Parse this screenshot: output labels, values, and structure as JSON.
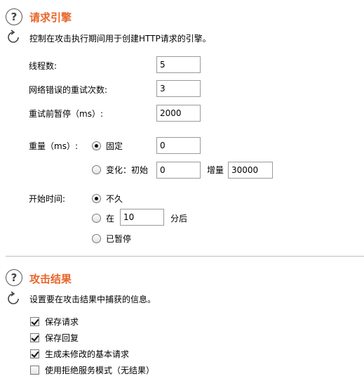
{
  "request_engine": {
    "title": "请求引擎",
    "description": "控制在攻击执行期间用于创建HTTP请求的引擎。",
    "threads_label": "线程数:",
    "threads_value": "5",
    "retries_label": "网络错误的重试次数:",
    "retries_value": "3",
    "pause_label": "重试前暂停（ms）:",
    "pause_value": "2000",
    "throttle_label": "重量（ms）:",
    "throttle_fixed_label": "固定",
    "throttle_fixed_value": "0",
    "throttle_fixed_selected": true,
    "throttle_variable_label": "变化：初始",
    "throttle_variable_initial": "0",
    "throttle_increment_label": "增量",
    "throttle_increment_value": "30000",
    "start_time_label": "开始时间:",
    "start_immediately_label": "不久",
    "start_immediately_selected": true,
    "start_in_label": "在",
    "start_in_value": "10",
    "start_in_unit": "分后",
    "start_paused_label": "已暂停"
  },
  "attack_results": {
    "title": "攻击结果",
    "description": "设置要在攻击结果中捕获的信息。",
    "options": [
      {
        "label": "保存请求",
        "checked": true
      },
      {
        "label": "保存回复",
        "checked": true
      },
      {
        "label": "生成未修改的基本请求",
        "checked": true
      },
      {
        "label": "使用拒绝服务模式（无结果）",
        "checked": false
      }
    ]
  },
  "icons": {
    "help": "question-mark-icon",
    "refresh": "refresh-icon",
    "accent_color": "#e8662a"
  }
}
